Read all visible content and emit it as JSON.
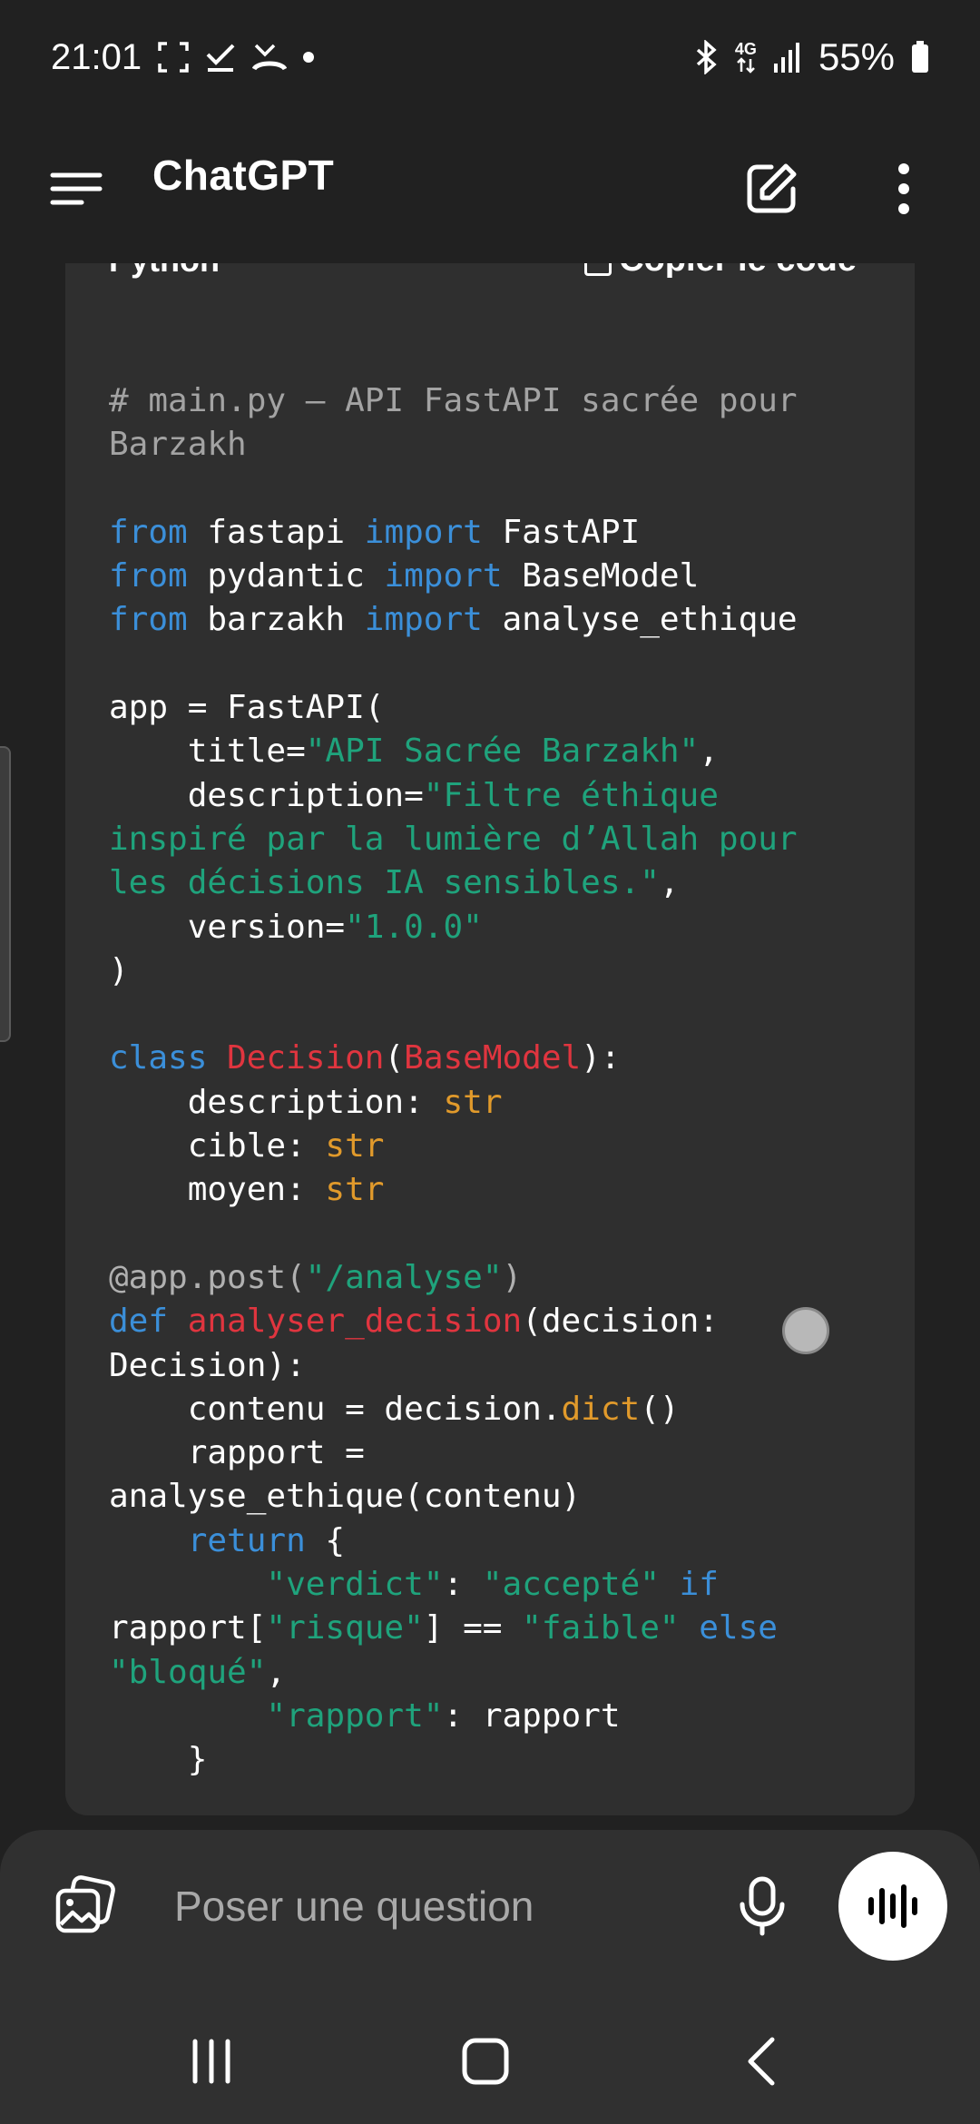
{
  "status_bar": {
    "time": "21:01",
    "left_icons": [
      "screenshot-frame-icon",
      "check-icon",
      "missed-call-icon",
      "dot-icon"
    ],
    "right_icons": [
      "bluetooth-icon",
      "network-4g-icon",
      "signal-icon",
      "battery-icon"
    ],
    "network_label": "4G",
    "battery": "55%"
  },
  "header": {
    "title": "ChatGPT",
    "menu_icon": "hamburger-menu-icon",
    "new_chat_icon": "edit-icon",
    "more_icon": "more-vertical-icon"
  },
  "code_block": {
    "language": "Python",
    "copy_label": "Copier le code",
    "lines": [
      [
        {
          "t": "# main.py – API FastAPI sacrée pour",
          "c": "comment"
        }
      ],
      [
        {
          "t": "Barzakh",
          "c": "comment"
        }
      ],
      [],
      [
        {
          "t": "from",
          "c": "kw"
        },
        {
          "t": " fastapi ",
          "c": ""
        },
        {
          "t": "import",
          "c": "kw"
        },
        {
          "t": " FastAPI",
          "c": ""
        }
      ],
      [
        {
          "t": "from",
          "c": "kw"
        },
        {
          "t": " pydantic ",
          "c": ""
        },
        {
          "t": "import",
          "c": "kw"
        },
        {
          "t": " BaseModel",
          "c": ""
        }
      ],
      [
        {
          "t": "from",
          "c": "kw"
        },
        {
          "t": " barzakh ",
          "c": ""
        },
        {
          "t": "import",
          "c": "kw"
        },
        {
          "t": " analyse_ethique",
          "c": ""
        }
      ],
      [],
      [
        {
          "t": "app = FastAPI(",
          "c": ""
        }
      ],
      [
        {
          "t": "    title=",
          "c": ""
        },
        {
          "t": "\"API Sacrée Barzakh\"",
          "c": "str"
        },
        {
          "t": ",",
          "c": ""
        }
      ],
      [
        {
          "t": "    description=",
          "c": ""
        },
        {
          "t": "\"Filtre éthique",
          "c": "str"
        }
      ],
      [
        {
          "t": "inspiré par la lumière d’Allah pour",
          "c": "str"
        }
      ],
      [
        {
          "t": "les décisions IA sensibles.\"",
          "c": "str"
        },
        {
          "t": ",",
          "c": ""
        }
      ],
      [
        {
          "t": "    version=",
          "c": ""
        },
        {
          "t": "\"1.0.0\"",
          "c": "str"
        }
      ],
      [
        {
          "t": ")",
          "c": ""
        }
      ],
      [],
      [
        {
          "t": "class",
          "c": "kw"
        },
        {
          "t": " ",
          "c": ""
        },
        {
          "t": "Decision",
          "c": "cls"
        },
        {
          "t": "(",
          "c": ""
        },
        {
          "t": "BaseModel",
          "c": "cls"
        },
        {
          "t": "):",
          "c": ""
        }
      ],
      [
        {
          "t": "    description: ",
          "c": ""
        },
        {
          "t": "str",
          "c": "type"
        }
      ],
      [
        {
          "t": "    cible: ",
          "c": ""
        },
        {
          "t": "str",
          "c": "type"
        }
      ],
      [
        {
          "t": "    moyen: ",
          "c": ""
        },
        {
          "t": "str",
          "c": "type"
        }
      ],
      [],
      [
        {
          "t": "@app.post(",
          "c": "dec"
        },
        {
          "t": "\"/analyse\"",
          "c": "str"
        },
        {
          "t": ")",
          "c": "dec"
        }
      ],
      [
        {
          "t": "def",
          "c": "kw"
        },
        {
          "t": " ",
          "c": ""
        },
        {
          "t": "analyser_decision",
          "c": "cls"
        },
        {
          "t": "(decision:",
          "c": ""
        }
      ],
      [
        {
          "t": "Decision):",
          "c": ""
        }
      ],
      [
        {
          "t": "    contenu = decision.",
          "c": ""
        },
        {
          "t": "dict",
          "c": "type"
        },
        {
          "t": "()",
          "c": ""
        }
      ],
      [
        {
          "t": "    rapport =",
          "c": ""
        }
      ],
      [
        {
          "t": "analyse_ethique(contenu)",
          "c": ""
        }
      ],
      [
        {
          "t": "    ",
          "c": ""
        },
        {
          "t": "return",
          "c": "kw"
        },
        {
          "t": " {",
          "c": ""
        }
      ],
      [
        {
          "t": "        ",
          "c": ""
        },
        {
          "t": "\"verdict\"",
          "c": "str"
        },
        {
          "t": ": ",
          "c": ""
        },
        {
          "t": "\"accepté\"",
          "c": "str"
        },
        {
          "t": " ",
          "c": ""
        },
        {
          "t": "if",
          "c": "kw"
        }
      ],
      [
        {
          "t": "rapport[",
          "c": ""
        },
        {
          "t": "\"risque\"",
          "c": "str"
        },
        {
          "t": "] == ",
          "c": ""
        },
        {
          "t": "\"faible\"",
          "c": "str"
        },
        {
          "t": " ",
          "c": ""
        },
        {
          "t": "else",
          "c": "kw"
        }
      ],
      [
        {
          "t": "\"bloqué\"",
          "c": "str"
        },
        {
          "t": ",",
          "c": ""
        }
      ],
      [
        {
          "t": "        ",
          "c": ""
        },
        {
          "t": "\"rapport\"",
          "c": "str"
        },
        {
          "t": ": rapport",
          "c": ""
        }
      ],
      [
        {
          "t": "    }",
          "c": ""
        }
      ]
    ]
  },
  "composer": {
    "placeholder": "Poser une question",
    "attach_icon": "image-attach-icon",
    "mic_icon": "microphone-icon",
    "voice_icon": "voice-mode-icon"
  },
  "nav_bar": {
    "recents_icon": "recents-icon",
    "home_icon": "home-icon",
    "back_icon": "back-icon"
  },
  "colors": {
    "background": "#212121",
    "code_background": "#2f2f2f",
    "keyword": "#3b8fd9",
    "string": "#1fa37c",
    "class_name": "#e0353f",
    "type": "#e19a2b",
    "comment": "#a3a3a3"
  }
}
